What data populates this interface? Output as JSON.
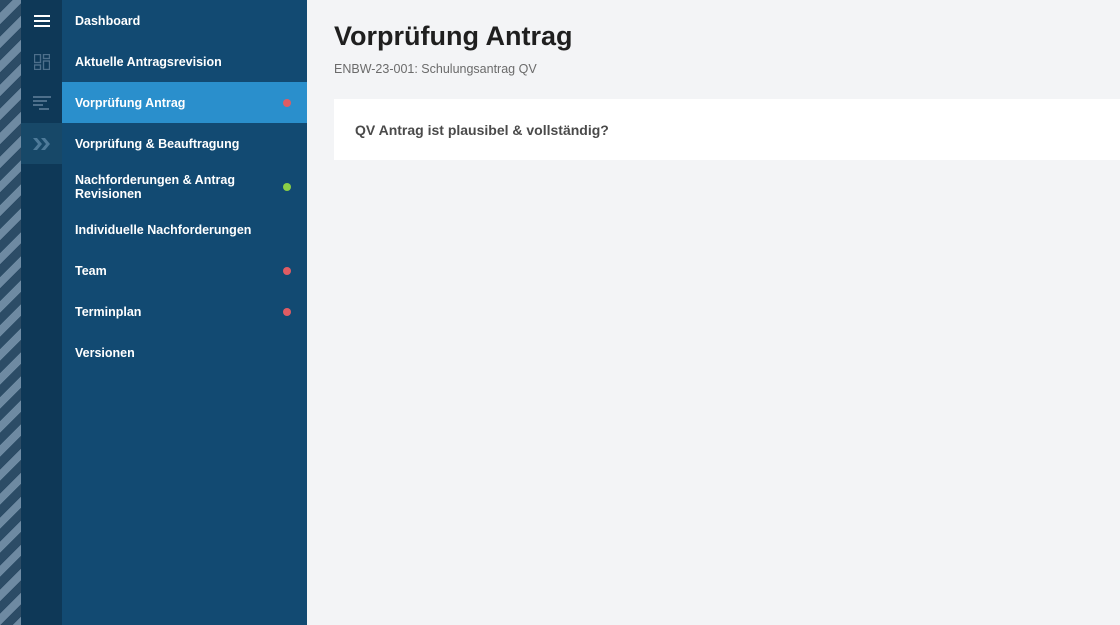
{
  "icons": {
    "menu": "hamburger-menu-icon",
    "dashboard": "dashboard-grid-icon",
    "filter": "filter-lines-icon",
    "collapse": "double-chevron-right-icon"
  },
  "colors": {
    "stripe_dark": "#2c4c66",
    "stripe_light": "#6e8aa2",
    "icon_rail": "#0e3857",
    "nav_bg": "#124a72",
    "nav_active": "#2a8fcc",
    "status_red": "#e05c63",
    "status_green": "#8bcf46",
    "main_bg": "#f3f4f6"
  },
  "sidebar": {
    "items": [
      {
        "label": "Dashboard",
        "status": null,
        "active": false
      },
      {
        "label": "Aktuelle Antragsrevision",
        "status": null,
        "active": false
      },
      {
        "label": "Vorprüfung Antrag",
        "status": "red",
        "active": true
      },
      {
        "label": "Vorprüfung & Beauftragung",
        "status": null,
        "active": false
      },
      {
        "label": "Nachforderungen & Antrag Revisionen",
        "status": "green",
        "active": false
      },
      {
        "label": "Individuelle Nachforderungen",
        "status": null,
        "active": false
      },
      {
        "label": "Team",
        "status": "red",
        "active": false
      },
      {
        "label": "Terminplan",
        "status": "red",
        "active": false
      },
      {
        "label": "Versionen",
        "status": null,
        "active": false
      }
    ]
  },
  "main": {
    "title": "Vorprüfung Antrag",
    "subtitle": "ENBW-23-001: Schulungsantrag QV",
    "card": {
      "question": "QV Antrag ist plausibel & vollständig?"
    }
  }
}
